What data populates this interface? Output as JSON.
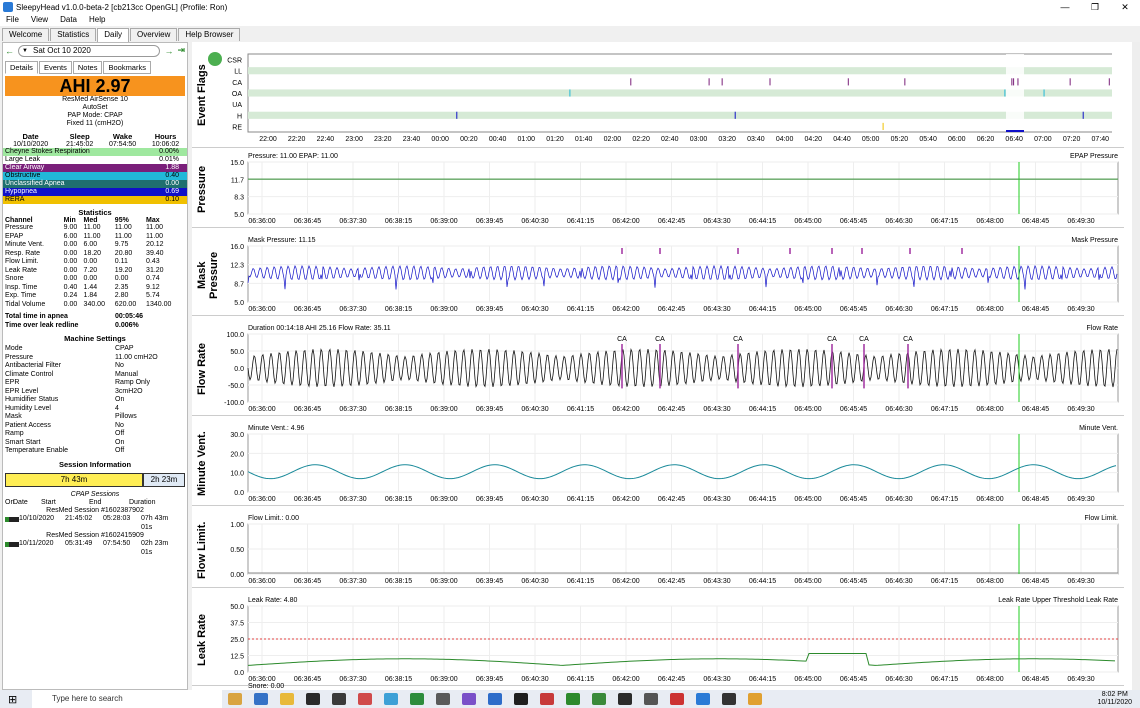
{
  "window": {
    "title": "SleepyHead v1.0.0-beta-2 [cb213cc OpenGL] (Profile: Ron)"
  },
  "menu": [
    "File",
    "View",
    "Data",
    "Help"
  ],
  "tabs": [
    "Welcome",
    "Statistics",
    "Daily",
    "Overview",
    "Help Browser"
  ],
  "date": "Sat Oct 10 2020",
  "subtabs": [
    "Details",
    "Events",
    "Notes",
    "Bookmarks"
  ],
  "ahi": "AHI 2.97",
  "machine": {
    "name": "ResMed AirSense 10",
    "mode1": "AutoSet",
    "mode2": "PAP Mode: CPAP",
    "mode3": "Fixed 11 (cmH2O)"
  },
  "summary": {
    "headers": [
      "Date",
      "Sleep",
      "Wake",
      "Hours"
    ],
    "values": [
      "10/10/2020",
      "21:45:02",
      "07:54:50",
      "10:06:02"
    ]
  },
  "events": [
    {
      "name": "Cheyne Stokes Respiration",
      "value": "0.00%",
      "color": "#9fe89f"
    },
    {
      "name": "Large Leak",
      "value": "0.01%",
      "color": "#ffffff"
    },
    {
      "name": "Clear Airway",
      "value": "1.88",
      "color": "#7a1f7a"
    },
    {
      "name": "Obstructive",
      "value": "0.40",
      "color": "#22b8d8"
    },
    {
      "name": "Unclassified Apnea",
      "value": "0.00",
      "color": "#1f6f6f"
    },
    {
      "name": "Hypopnea",
      "value": "0.69",
      "color": "#1010c8"
    },
    {
      "name": "RERA",
      "value": "0.10",
      "color": "#f0c000"
    }
  ],
  "stats": {
    "title": "Statistics",
    "headers": [
      "Channel",
      "Min",
      "Med",
      "95%",
      "Max"
    ],
    "rows": [
      [
        "Pressure",
        "9.00",
        "11.00",
        "11.00",
        "11.00"
      ],
      [
        "EPAP",
        "6.00",
        "11.00",
        "11.00",
        "11.00"
      ],
      [
        "Minute Vent.",
        "0.00",
        "6.00",
        "9.75",
        "20.12"
      ],
      [
        "Resp. Rate",
        "0.00",
        "18.20",
        "20.80",
        "39.40"
      ],
      [
        "Flow Limit.",
        "0.00",
        "0.00",
        "0.11",
        "0.43"
      ],
      [
        "Leak Rate",
        "0.00",
        "7.20",
        "19.20",
        "31.20"
      ],
      [
        "Snore",
        "0.00",
        "0.00",
        "0.00",
        "0.74"
      ],
      [
        "Insp. Time",
        "0.40",
        "1.44",
        "2.35",
        "9.12"
      ],
      [
        "Exp. Time",
        "0.24",
        "1.84",
        "2.80",
        "5.74"
      ],
      [
        "Tidal Volume",
        "0.00",
        "340.00",
        "620.00",
        "1340.00"
      ]
    ]
  },
  "apnea": [
    {
      "k": "Total time in apnea",
      "v": "00:05:46"
    },
    {
      "k": "Time over leak redline",
      "v": "0.006%"
    }
  ],
  "settings_title": "Machine Settings",
  "settings": [
    {
      "k": "Mode",
      "v": "CPAP"
    },
    {
      "k": "Pressure",
      "v": "11.00 cmH2O"
    },
    {
      "k": "Antibacterial Filter",
      "v": "No"
    },
    {
      "k": "Climate Control",
      "v": "Manual"
    },
    {
      "k": "EPR",
      "v": "Ramp Only"
    },
    {
      "k": "EPR Level",
      "v": "3cmH2O"
    },
    {
      "k": "Humidifier Status",
      "v": "On"
    },
    {
      "k": "Humidity Level",
      "v": "4"
    },
    {
      "k": "Mask",
      "v": "Pillows"
    },
    {
      "k": "Patient Access",
      "v": "No"
    },
    {
      "k": "Ramp",
      "v": "Off"
    },
    {
      "k": "Smart Start",
      "v": "On"
    },
    {
      "k": "Temperature Enable",
      "v": "Off"
    }
  ],
  "session_title": "Session Information",
  "session_bar": {
    "a": "7h 43m",
    "b": "2h 23m"
  },
  "cpap_title": "CPAP Sessions",
  "sess_headers": [
    "On",
    "Date",
    "Start",
    "End",
    "Duration"
  ],
  "sessions": [
    {
      "label": "ResMed Session #1602387902",
      "date": "10/10/2020",
      "start": "21:45:02",
      "end": "05:28:03",
      "dur": "07h 43m 01s"
    },
    {
      "label": "ResMed Session #1602415909",
      "date": "10/11/2020",
      "start": "05:31:49",
      "end": "07:54:50",
      "dur": "02h 23m 01s"
    }
  ],
  "eventflags": {
    "title": "Event Flags",
    "rows": [
      "CSR",
      "LL",
      "CA",
      "OA",
      "UA",
      "H",
      "RE"
    ],
    "ticks": [
      "22:00",
      "22:20",
      "22:40",
      "23:00",
      "23:20",
      "23:40",
      "00:00",
      "00:20",
      "00:40",
      "01:00",
      "01:20",
      "01:40",
      "02:00",
      "02:20",
      "02:40",
      "03:00",
      "03:20",
      "03:40",
      "04:00",
      "04:20",
      "04:40",
      "05:00",
      "05:20",
      "05:40",
      "06:00",
      "06:20",
      "06:40",
      "07:00",
      "07:20",
      "07:40"
    ]
  },
  "timeticks": [
    "06:36:00",
    "06:36:45",
    "06:37:30",
    "06:38:15",
    "06:39:00",
    "06:39:45",
    "06:40:30",
    "06:41:15",
    "06:42:00",
    "06:42:45",
    "06:43:30",
    "06:44:15",
    "06:45:00",
    "06:45:45",
    "06:46:30",
    "06:47:15",
    "06:48:00",
    "06:48:45",
    "06:49:30"
  ],
  "graphs": [
    {
      "label": "Pressure",
      "info": "Pressure: 11.00 EPAP: 11.00",
      "legend": "EPAP  Pressure",
      "ticks": [
        "15.0",
        "11.7",
        "8.3",
        "5.0"
      ]
    },
    {
      "label": "Mask Pressure",
      "info": "Mask Pressure: 11.15",
      "legend": "Mask Pressure",
      "ticks": [
        "16.0",
        "12.3",
        "8.7",
        "5.0"
      ]
    },
    {
      "label": "Flow Rate",
      "info": "Duration 00:14:18 AHI 25.16 Flow Rate: 35.11",
      "legend": "Flow Rate",
      "ticks": [
        "100.0",
        "50.0",
        "0.0",
        "-50.0",
        "-100.0"
      ]
    },
    {
      "label": "Minute Vent.",
      "info": "Minute Vent.: 4.96",
      "legend": "Minute Vent.",
      "ticks": [
        "30.0",
        "20.0",
        "10.0",
        "0.0"
      ]
    },
    {
      "label": "Flow Limit.",
      "info": "Flow Limit.: 0.00",
      "legend": "Flow Limit.",
      "ticks": [
        "1.00",
        "0.50",
        "0.00"
      ]
    },
    {
      "label": "Leak Rate",
      "info": "Leak Rate: 4.80",
      "legend": "Leak Rate Upper Threshold  Leak Rate",
      "ticks": [
        "50.0",
        "37.5",
        "25.0",
        "12.5",
        "0.0"
      ]
    }
  ],
  "snore_info": "Snore: 0.00",
  "ca_label": "CA",
  "taskbar": {
    "search": "Type here to search",
    "time": "8:02 PM",
    "date": "10/11/2020"
  }
}
